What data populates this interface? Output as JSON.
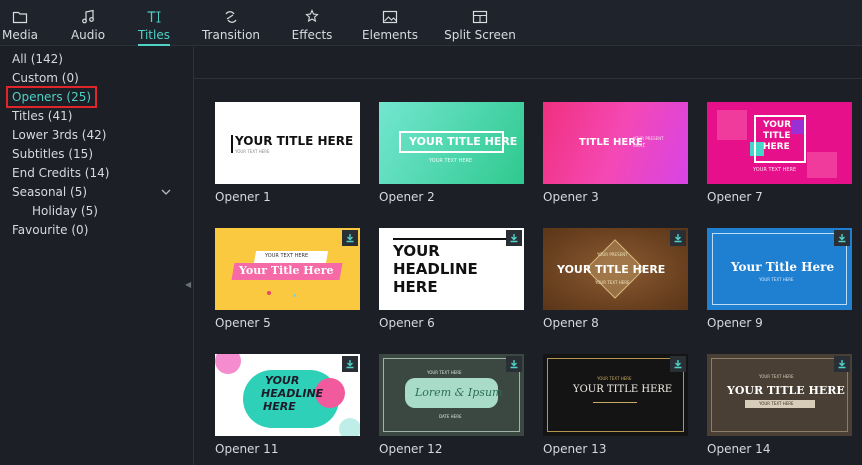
{
  "toolbar": {
    "tabs": [
      {
        "label": "Media"
      },
      {
        "label": "Audio"
      },
      {
        "label": "Titles"
      },
      {
        "label": "Transition"
      },
      {
        "label": "Effects"
      },
      {
        "label": "Elements"
      },
      {
        "label": "Split Screen"
      }
    ],
    "active_tab": "Titles",
    "accent": "#4fd1c5"
  },
  "sidebar": {
    "items": [
      {
        "label": "All (142)"
      },
      {
        "label": "Custom (0)"
      },
      {
        "label": "Openers (25)"
      },
      {
        "label": "Titles (41)"
      },
      {
        "label": "Lower 3rds (42)"
      },
      {
        "label": "Subtitles (15)"
      },
      {
        "label": "End Credits (14)"
      },
      {
        "label": "Seasonal (5)"
      },
      {
        "label": "Holiday (5)"
      },
      {
        "label": "Favourite (0)"
      }
    ],
    "selected": "Openers (25)"
  },
  "cards": [
    {
      "name": "Opener 1",
      "text": [
        "YOUR TITLE HERE",
        "YOUR TEXT HERE"
      ]
    },
    {
      "name": "Opener 2",
      "text": [
        "YOUR TITLE HERE",
        "YOUR TEXT HERE"
      ]
    },
    {
      "name": "Opener 3",
      "text": [
        "TITLE HERE",
        "YOUR PRESENT",
        "text"
      ]
    },
    {
      "name": "Opener 7",
      "text": [
        "YOUR",
        "TITLE",
        "HERE",
        "YOUR TEXT HERE"
      ]
    },
    {
      "name": "Opener 5",
      "text": [
        "YOUR TEXT HERE",
        "Your Title Here"
      ]
    },
    {
      "name": "Opener 6",
      "text": [
        "YOUR",
        "HEADLINE",
        "HERE"
      ]
    },
    {
      "name": "Opener 8",
      "text": [
        "YOUR PRESENT",
        "YOUR TITLE HERE",
        "YOUR TEXT HERE"
      ]
    },
    {
      "name": "Opener 9",
      "text": [
        "Your Title Here",
        "YOUR TEXT HERE"
      ]
    },
    {
      "name": "Opener 11",
      "text": [
        "YOUR",
        "HEADLINE",
        "HERE"
      ]
    },
    {
      "name": "Opener 12",
      "text": [
        "YOUR TEXT HERE",
        "Lorem & Ipsum",
        "DATE HERE"
      ]
    },
    {
      "name": "Opener 13",
      "text": [
        "YOUR TEXT HERE",
        "YOUR TITLE HERE"
      ]
    },
    {
      "name": "Opener 14",
      "text": [
        "YOUR TEXT HERE",
        "YOUR TITLE HERE",
        "YOUR TEXT HERE"
      ]
    }
  ]
}
